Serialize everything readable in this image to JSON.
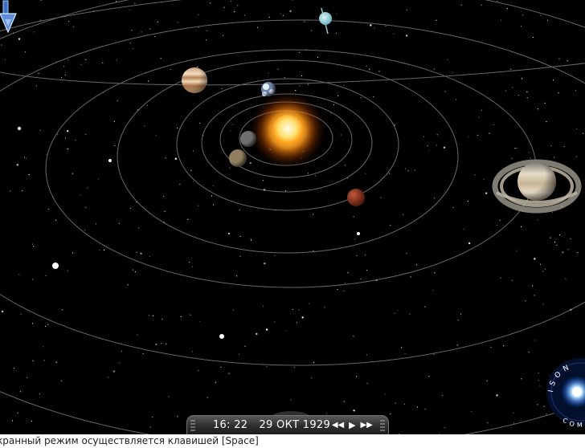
{
  "playback": {
    "time": "16: 22",
    "date": "29 ОКТ 1929",
    "rewind_symbol": "◀◀",
    "play_symbol": "▶",
    "forward_symbol": "▶▶"
  },
  "status": {
    "text": "кранный режим осуществляется клавишей [Space]"
  },
  "badge": {
    "text": "ISON COMET"
  },
  "colors": {
    "background": "#000000",
    "sun": "#ffb020",
    "orbit": "#8a8a8a"
  }
}
